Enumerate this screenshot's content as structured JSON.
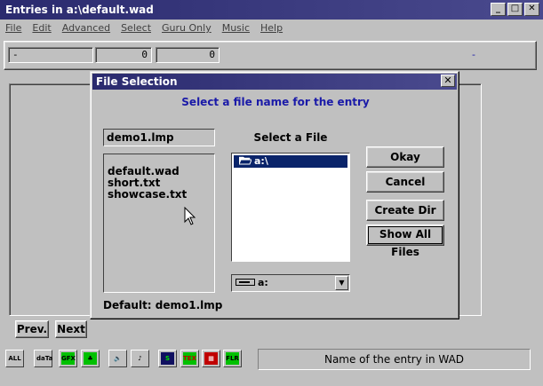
{
  "window": {
    "title": "Entries in a:\\default.wad",
    "min_glyph": "_",
    "max_glyph": "□",
    "close_glyph": "✕"
  },
  "menu": [
    "File",
    "Edit",
    "Advanced",
    "Select",
    "Guru Only",
    "Music",
    "Help"
  ],
  "toolbar": {
    "field1": "-",
    "field2": "0",
    "field3": "0",
    "right_dash": "-"
  },
  "nav": {
    "prev_label": "Prev.",
    "next_label": "Next"
  },
  "icons": [
    {
      "name": "all-icon",
      "label": "ALL",
      "bg": "#c0c0c0",
      "fg": "#000000"
    },
    {
      "name": "data-icon",
      "label": "daTa",
      "bg": "#c0c0c0",
      "fg": "#000000"
    },
    {
      "name": "gfx-icon",
      "label": "GFX",
      "bg": "#00c000",
      "fg": "#000000"
    },
    {
      "name": "tree-icon",
      "label": "♣",
      "bg": "#00c000",
      "fg": "#000000"
    },
    {
      "name": "sound-icon",
      "label": "🔈",
      "bg": "#c0c0c0",
      "fg": "#000000"
    },
    {
      "name": "music-icon",
      "label": "♪",
      "bg": "#c0c0c0",
      "fg": "#000000"
    },
    {
      "name": "sprite-icon",
      "label": "S",
      "bg": "#101060",
      "fg": "#00e000"
    },
    {
      "name": "texture-icon",
      "label": "TEX",
      "bg": "#00c000",
      "fg": "#c00000"
    },
    {
      "name": "patch-icon",
      "label": "▦",
      "bg": "#c00000",
      "fg": "#ffffff"
    },
    {
      "name": "flat-icon",
      "label": "FLR",
      "bg": "#00c000",
      "fg": "#000000"
    }
  ],
  "status": "Name of the entry in WAD",
  "dialog": {
    "title": "File Selection",
    "close_glyph": "✕",
    "prompt": "Select a file name for the entry",
    "filename": "demo1.lmp",
    "files": [
      "default.wad",
      "short.txt",
      "showcase.txt"
    ],
    "default_label": "Default:  demo1.lmp",
    "dir_label": "Select a File",
    "dir_selected": "a:\\",
    "drive": "a:",
    "okay_label": "Okay",
    "cancel_label": "Cancel",
    "createdir_label": "Create Dir",
    "showall_label": "Show All Files"
  }
}
